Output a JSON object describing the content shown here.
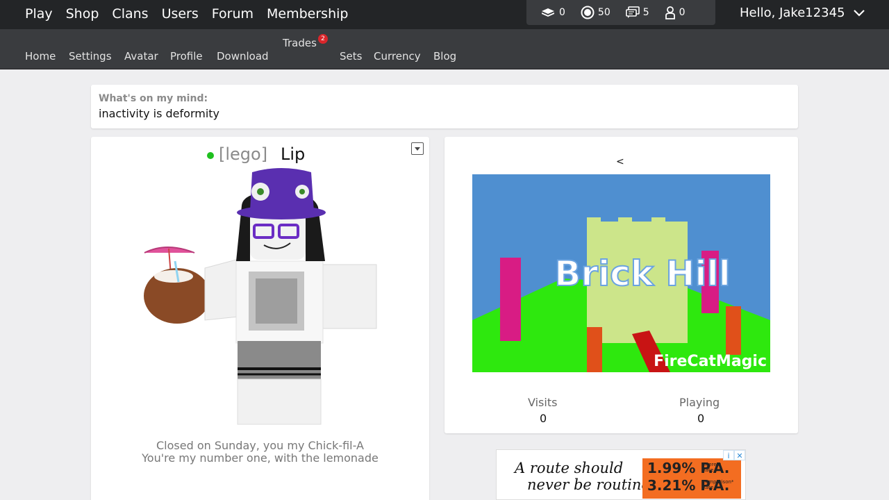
{
  "topnav": [
    "Play",
    "Shop",
    "Clans",
    "Users",
    "Forum",
    "Membership"
  ],
  "stats": {
    "bricks": "0",
    "bits": "50",
    "messages": "5",
    "friend_requests": "0"
  },
  "user": {
    "greeting": "Hello, Jake12345"
  },
  "subnav": {
    "home": "Home",
    "settings": "Settings",
    "avatar": "Avatar",
    "profile": "Profile",
    "download": "Download",
    "trades": "Trades",
    "trades_badge": "2",
    "sets": "Sets",
    "currency": "Currency",
    "blog": "Blog"
  },
  "mind": {
    "label": "What's on my mind:",
    "text": "inactivity is deformity"
  },
  "profile": {
    "clan_tag": "[lego]",
    "username": "Lip",
    "online": true,
    "bio_line1": "Closed on Sunday, you my Chick-fil-A",
    "bio_line2": "You're my number one, with the lemonade"
  },
  "game": {
    "prev": "<",
    "thumb_title": "Brick Hill",
    "thumb_author": "FireCatMagic",
    "visits_label": "Visits",
    "visits": "0",
    "playing_label": "Playing",
    "playing": "0"
  },
  "ad": {
    "line1": "A route should",
    "line2": "never be routine.",
    "rate1": "1.99% P.A.",
    "rate1_note1": "Interest",
    "rate1_note2": "Rate",
    "rate2": "3.21% P.A.",
    "rate2_note1": "Comparison*",
    "rate2_note2": "Rate",
    "info_icon": "i",
    "close_icon": "✕"
  },
  "colors": {
    "topbar": "#232527",
    "subbar": "#3a3c3f",
    "online": "#1fc01f",
    "badge": "#d9262b",
    "ad_accent": "#f36d21"
  }
}
